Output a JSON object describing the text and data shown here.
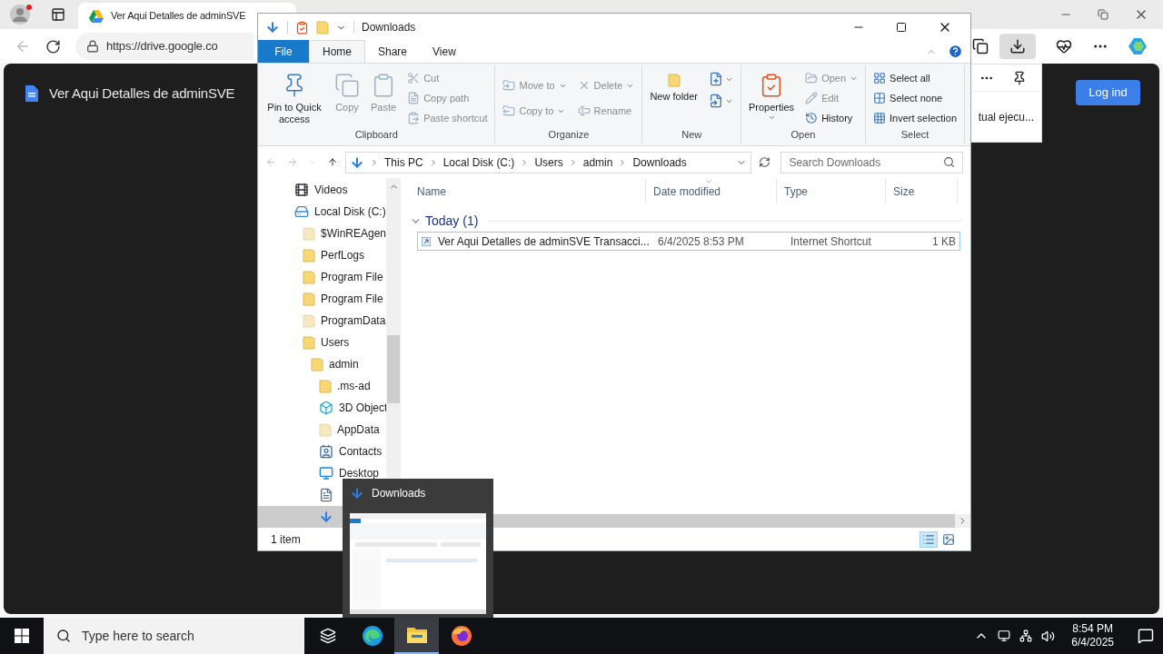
{
  "browser": {
    "tab_title": "Ver Aqui Detalles de adminSVE",
    "url": "https://drive.google.co",
    "document_title": "Ver Aqui Detalles de adminSVE",
    "downloads_open": true,
    "downloads_panel": {
      "item_text": "tual ejecu..."
    },
    "login_button": "Log ind"
  },
  "explorer": {
    "title": "Downloads",
    "ribbon_tabs": [
      {
        "label": "File",
        "kind": "file",
        "selected": false
      },
      {
        "label": "Home",
        "kind": "tab",
        "selected": true
      },
      {
        "label": "Share",
        "kind": "tab",
        "selected": false
      },
      {
        "label": "View",
        "kind": "tab",
        "selected": false
      }
    ],
    "ribbon_groups": [
      {
        "label": "Clipboard",
        "buttons": [
          {
            "kind": "large",
            "label": "Pin to Quick access",
            "disabled": false,
            "dropdown": false
          },
          {
            "kind": "large",
            "label": "Copy",
            "disabled": true,
            "dropdown": false
          },
          {
            "kind": "large",
            "label": "Paste",
            "disabled": true,
            "dropdown": false
          },
          {
            "kind": "small",
            "label": "Cut",
            "disabled": true,
            "dropdown": false
          },
          {
            "kind": "small",
            "label": "Copy path",
            "disabled": true,
            "dropdown": false
          },
          {
            "kind": "small",
            "label": "Paste shortcut",
            "disabled": true,
            "dropdown": false
          }
        ]
      },
      {
        "label": "Organize",
        "buttons": [
          {
            "kind": "small",
            "label": "Move to",
            "disabled": true,
            "dropdown": true
          },
          {
            "kind": "small",
            "label": "Copy to",
            "disabled": true,
            "dropdown": true
          },
          {
            "kind": "small",
            "label": "Delete",
            "disabled": true,
            "dropdown": true
          },
          {
            "kind": "small",
            "label": "Rename",
            "disabled": true,
            "dropdown": false
          }
        ]
      },
      {
        "label": "New",
        "buttons": [
          {
            "kind": "large",
            "label": "New folder",
            "disabled": false,
            "dropdown": false
          },
          {
            "kind": "icon",
            "disabled": false,
            "dropdown": true
          },
          {
            "kind": "icon",
            "disabled": false,
            "dropdown": true
          }
        ]
      },
      {
        "label": "Open",
        "buttons": [
          {
            "kind": "large",
            "label": "Properties",
            "disabled": false,
            "dropdown": true
          },
          {
            "kind": "small",
            "label": "Open",
            "disabled": true,
            "dropdown": true
          },
          {
            "kind": "small",
            "label": "Edit",
            "disabled": true,
            "dropdown": false
          },
          {
            "kind": "small",
            "label": "History",
            "disabled": false,
            "dropdown": false
          }
        ]
      },
      {
        "label": "Select",
        "buttons": [
          {
            "kind": "small",
            "label": "Select all",
            "disabled": false,
            "dropdown": false
          },
          {
            "kind": "small",
            "label": "Select none",
            "disabled": false,
            "dropdown": false
          },
          {
            "kind": "small",
            "label": "Invert selection",
            "disabled": false,
            "dropdown": false
          }
        ]
      }
    ],
    "nav_buttons": [
      {
        "kind": "back",
        "disabled": true
      },
      {
        "kind": "forward",
        "disabled": true
      },
      {
        "kind": "recent",
        "disabled": true
      },
      {
        "kind": "up",
        "disabled": false
      }
    ],
    "breadcrumb": [
      "This PC",
      "Local Disk (C:)",
      "Users",
      "admin",
      "Downloads"
    ],
    "search": {
      "placeholder": "Search Downloads"
    },
    "navigation": [
      {
        "label": "Videos",
        "kind": "videos",
        "selected": false
      },
      {
        "label": "Local Disk (C:)",
        "kind": "drive",
        "selected": false,
        "children": [
          {
            "label": "$WinREAgen",
            "kind": "folder",
            "hidden": true,
            "selected": false
          },
          {
            "label": "PerfLogs",
            "kind": "folder",
            "hidden": false,
            "selected": false
          },
          {
            "label": "Program File",
            "kind": "folder",
            "hidden": false,
            "selected": false
          },
          {
            "label": "Program File",
            "kind": "folder",
            "hidden": false,
            "selected": false
          },
          {
            "label": "ProgramData",
            "kind": "folder",
            "hidden": true,
            "selected": false
          },
          {
            "label": "Users",
            "kind": "folder",
            "hidden": false,
            "selected": false,
            "children": [
              {
                "label": "admin",
                "kind": "folder",
                "hidden": false,
                "selected": false,
                "children": [
                  {
                    "label": ".ms-ad",
                    "kind": "folder",
                    "hidden": false,
                    "selected": false
                  },
                  {
                    "label": "3D Object",
                    "kind": "objects3d",
                    "selected": false
                  },
                  {
                    "label": "AppData",
                    "kind": "folder",
                    "hidden": true,
                    "selected": false
                  },
                  {
                    "label": "Contacts",
                    "kind": "contacts",
                    "selected": false
                  },
                  {
                    "label": "Desktop",
                    "kind": "desktop",
                    "selected": false
                  },
                  {
                    "kind": "documents",
                    "selected": false
                  },
                  {
                    "kind": "downloads",
                    "selected": true
                  }
                ]
              }
            ]
          }
        ]
      }
    ],
    "columns": [
      {
        "label": "Name",
        "sorted": false
      },
      {
        "label": "Date modified",
        "sorted": true
      },
      {
        "label": "Type",
        "sorted": false
      },
      {
        "label": "Size",
        "sorted": false
      }
    ],
    "groups": [
      {
        "label": "Today (1)",
        "expanded": true,
        "files": [
          {
            "name": "Ver Aqui Detalles de adminSVE Transacci...",
            "date": "6/4/2025 8:53 PM",
            "type": "Internet Shortcut",
            "size": "1 KB",
            "focused": true
          }
        ]
      }
    ],
    "status": "1 item",
    "views": [
      {
        "kind": "details",
        "selected": true
      },
      {
        "kind": "large_icons",
        "selected": false
      }
    ]
  },
  "thumbnail_popup": {
    "title": "Downloads"
  },
  "taskbar": {
    "search_placeholder": "Type here to search",
    "apps": [
      {
        "kind": "task_view",
        "active": false
      },
      {
        "kind": "edge",
        "active": false
      },
      {
        "kind": "explorer",
        "active": true
      },
      {
        "kind": "firefox",
        "active": false
      }
    ],
    "time": "8:54 PM",
    "date": "6/4/2025"
  }
}
